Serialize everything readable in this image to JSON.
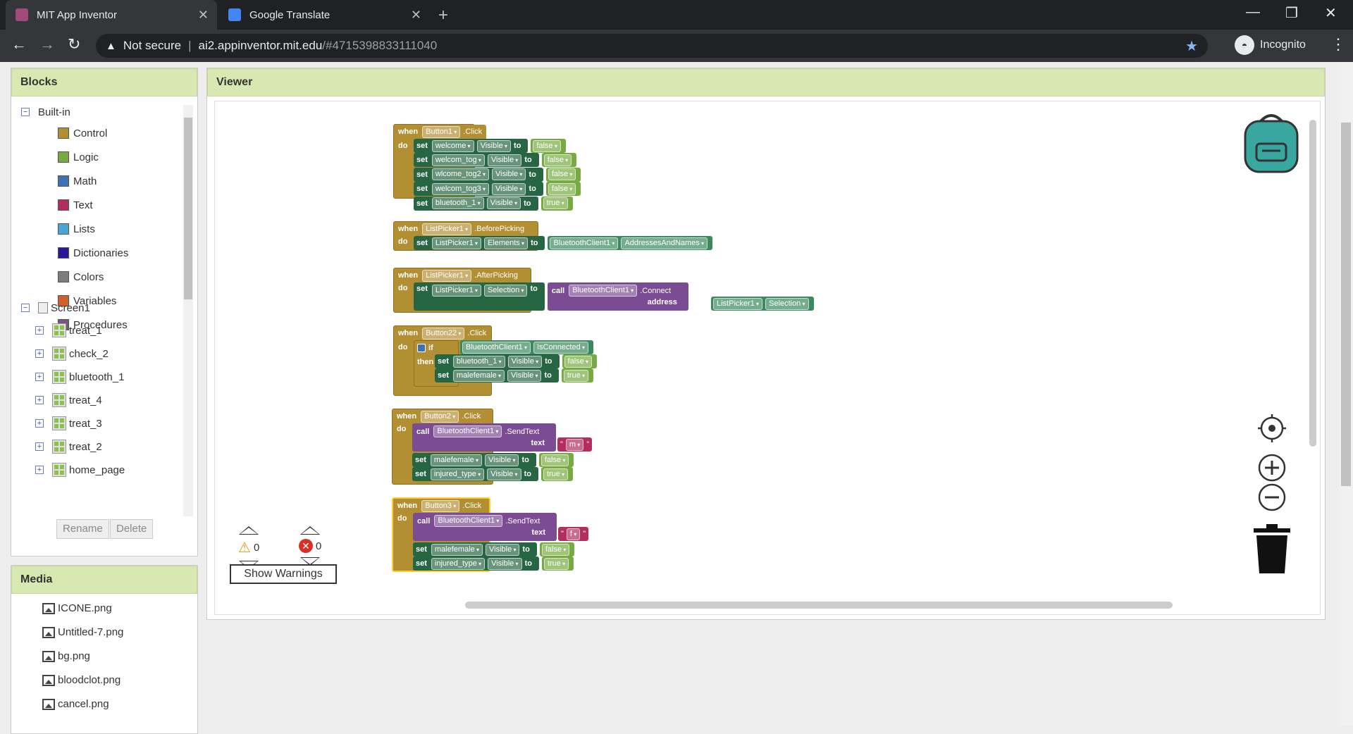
{
  "browser": {
    "tabs": [
      {
        "title": "MIT App Inventor",
        "active": true
      },
      {
        "title": "Google Translate",
        "active": false
      }
    ],
    "new_tab": "+",
    "security": "Not secure",
    "url_host": "ai2.appinventor.mit.edu",
    "url_path": "/#4715398833111040",
    "profile": "Incognito"
  },
  "blocks_panel": {
    "title": "Blocks",
    "builtin_label": "Built-in",
    "builtin": [
      {
        "label": "Control",
        "color": "#b38f34"
      },
      {
        "label": "Logic",
        "color": "#77ab41"
      },
      {
        "label": "Math",
        "color": "#3f71b5"
      },
      {
        "label": "Text",
        "color": "#b32d5e"
      },
      {
        "label": "Lists",
        "color": "#49a6d4"
      },
      {
        "label": "Dictionaries",
        "color": "#2d1799"
      },
      {
        "label": "Colors",
        "color": "#7d7d7d"
      },
      {
        "label": "Variables",
        "color": "#d05f2d"
      },
      {
        "label": "Procedures",
        "color": "#7c5385"
      }
    ],
    "screen_label": "Screen1",
    "components": [
      "treat_1",
      "check_2",
      "bluetooth_1",
      "treat_4",
      "treat_3",
      "treat_2",
      "home_page"
    ],
    "rename": "Rename",
    "delete": "Delete"
  },
  "media_panel": {
    "title": "Media",
    "files": [
      "ICONE.png",
      "Untitled-7.png",
      "bg.png",
      "bloodclot.png",
      "cancel.png"
    ]
  },
  "viewer": {
    "title": "Viewer",
    "warnings_count": "0",
    "errors_count": "0",
    "show_warnings": "Show Warnings",
    "blocks": {
      "b1": {
        "when": "when",
        "comp": "Button1",
        "event": ".Click",
        "do": "do",
        "rows": [
          {
            "set": "set",
            "comp": "welcome",
            "prop": "Visible",
            "to": "to",
            "val": "false"
          },
          {
            "set": "set",
            "comp": "welcom_tog",
            "prop": "Visible",
            "to": "to",
            "val": "false"
          },
          {
            "set": "set",
            "comp": "wlcome_tog2",
            "prop": "Visible",
            "to": "to",
            "val": "false"
          },
          {
            "set": "set",
            "comp": "welcom_tog3",
            "prop": "Visible",
            "to": "to",
            "val": "false"
          },
          {
            "set": "set",
            "comp": "bluetooth_1",
            "prop": "Visible",
            "to": "to",
            "val": "true"
          }
        ]
      },
      "b2": {
        "when": "when",
        "comp": "ListPicker1",
        "event": ".BeforePicking",
        "do": "do",
        "set": "set",
        "scomp": "ListPicker1",
        "prop": "Elements",
        "to": "to",
        "bt": "BluetoothClient1",
        "bprop": "AddressesAndNames"
      },
      "b3": {
        "when": "when",
        "comp": "ListPicker1",
        "event": ".AfterPicking",
        "do": "do",
        "set": "set",
        "scomp": "ListPicker1",
        "prop": "Selection",
        "to": "to",
        "call": "call",
        "bt": "BluetoothClient1",
        "method": ".Connect",
        "arg": "address",
        "acomp": "ListPicker1",
        "aprop": "Selection"
      },
      "b4": {
        "when": "when",
        "comp": "Button22",
        "event": ".Click",
        "do": "do",
        "if": "if",
        "then": "then",
        "bt": "BluetoothClient1",
        "cond": "IsConnected",
        "rows": [
          {
            "set": "set",
            "comp": "bluetooth_1",
            "prop": "Visible",
            "to": "to",
            "val": "false"
          },
          {
            "set": "set",
            "comp": "malefemale",
            "prop": "Visible",
            "to": "to",
            "val": "true"
          }
        ]
      },
      "b5": {
        "when": "when",
        "comp": "Button2",
        "event": ".Click",
        "do": "do",
        "call": "call",
        "bt": "BluetoothClient1",
        "method": ".SendText",
        "arg": "text",
        "str": "m",
        "rows": [
          {
            "set": "set",
            "comp": "malefemale",
            "prop": "Visible",
            "to": "to",
            "val": "false"
          },
          {
            "set": "set",
            "comp": "injured_type",
            "prop": "Visible",
            "to": "to",
            "val": "true"
          }
        ]
      },
      "b6": {
        "when": "when",
        "comp": "Button3",
        "event": ".Click",
        "do": "do",
        "call": "call",
        "bt": "BluetoothClient1",
        "method": ".SendText",
        "arg": "text",
        "str": "f",
        "rows": [
          {
            "set": "set",
            "comp": "malefemale",
            "prop": "Visible",
            "to": "to",
            "val": "false"
          },
          {
            "set": "set",
            "comp": "injured_type",
            "prop": "Visible",
            "to": "to",
            "val": "true"
          }
        ]
      }
    }
  }
}
